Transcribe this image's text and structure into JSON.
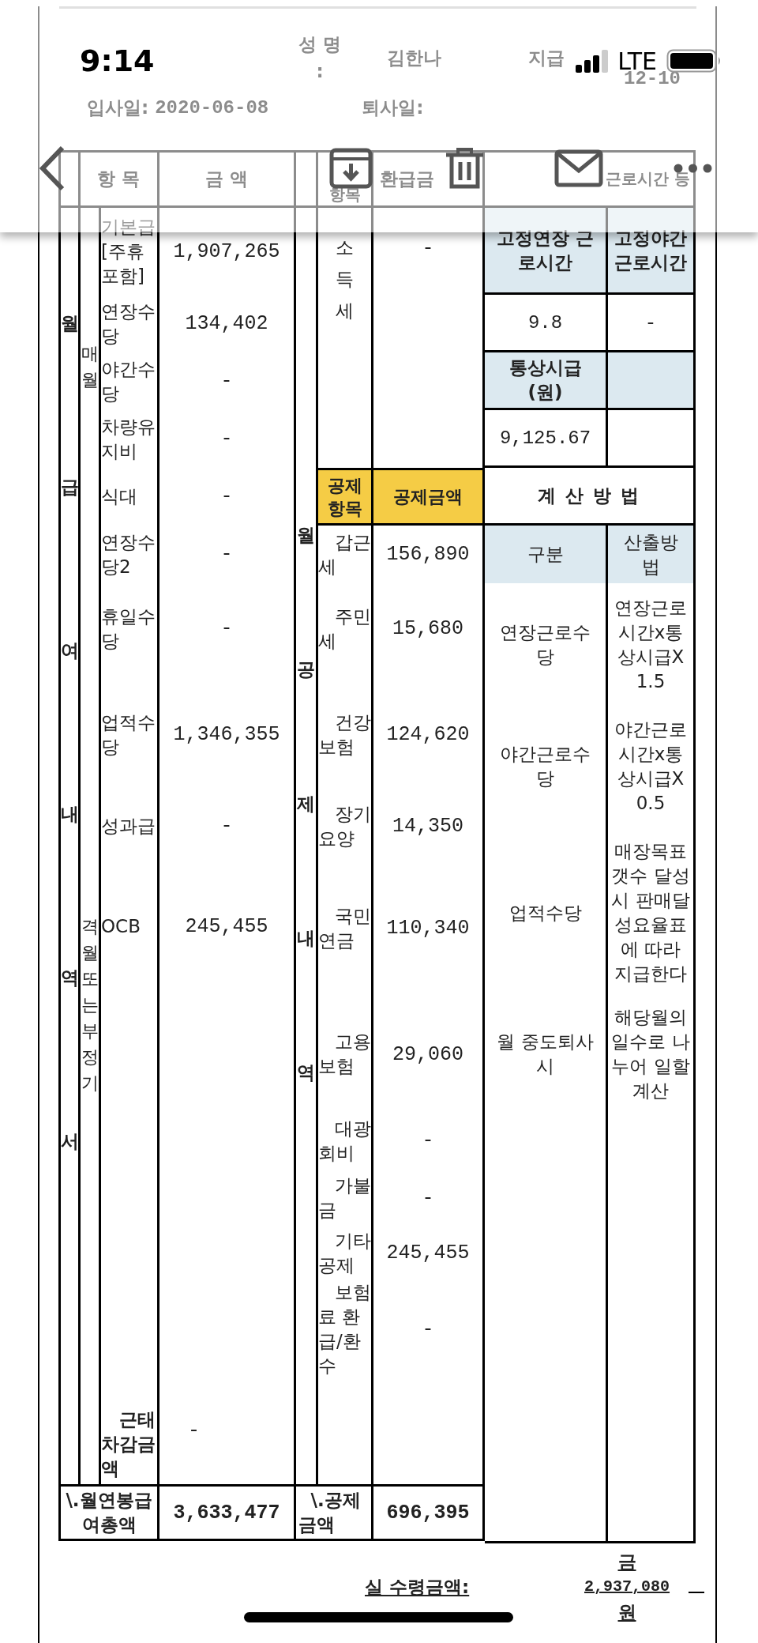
{
  "status_bar": {
    "time": "9:14",
    "network": "LTE"
  },
  "document_header": {
    "name_label": "성 명 :",
    "name": "김한나",
    "pay_date_label": "지급",
    "pay_date": "12-10",
    "hire_date_label": "입사일:",
    "hire_date": "2020-06-08",
    "leave_date_label": "퇴사일:"
  },
  "table_header": {
    "item": "항 목",
    "amount": "금 액",
    "deduction_item": "항목",
    "deduction_amount": "환급금",
    "hours": "근로시간 등"
  },
  "earnings": {
    "section_label": "월급여내역서",
    "groups": [
      {
        "label": "매월",
        "rows": [
          {
            "kind": "pay",
            "item": "기본급[주휴 포함]",
            "amount": "1,907,265"
          },
          {
            "kind": "pay",
            "item": "연장수당",
            "amount": "134,402"
          },
          {
            "kind": "pay",
            "item": "야간수당",
            "amount": "-"
          },
          {
            "kind": "pay",
            "item": "차량유지비",
            "amount": "-"
          },
          {
            "kind": "pay",
            "item": "식대",
            "amount": "-"
          }
        ]
      },
      {
        "label": "격월또는부정기",
        "rows": [
          {
            "kind": "pay",
            "item": "연장수당2",
            "amount": "-"
          },
          {
            "kind": "pay",
            "item": "휴일수당",
            "amount": "-"
          },
          {
            "kind": "pay",
            "item": "업적수당",
            "amount": "1,346,355"
          },
          {
            "kind": "pay",
            "item": "성과급",
            "amount": "-"
          },
          {
            "kind": "pay",
            "item": "OCB",
            "amount": "245,455"
          },
          {
            "kind": "attendance",
            "item": "근태차감금액",
            "amount": "-"
          }
        ]
      }
    ],
    "total": {
      "label": "\\.월연봉급여총액",
      "amount": "3,633,477"
    }
  },
  "deductions": {
    "section_label": "월공제내역",
    "income_tax": {
      "item": "소득세",
      "amount": "-"
    },
    "columns": [
      "공제항목",
      "공제금액"
    ],
    "rows": [
      {
        "item": "갑근세",
        "amount": "156,890"
      },
      {
        "item": "주민세",
        "amount": "15,680"
      },
      {
        "item": "건강보험",
        "amount": "124,620"
      },
      {
        "item": "장기요양",
        "amount": "14,350"
      },
      {
        "item": "국민연금",
        "amount": "110,340"
      },
      {
        "item": "고용보험",
        "amount": "29,060"
      },
      {
        "item": "대광회비",
        "amount": "-"
      },
      {
        "item": "가불금",
        "amount": "-"
      },
      {
        "item": "기타공제",
        "amount": "245,455"
      },
      {
        "item": "보험료 환급/환수",
        "amount": "-"
      }
    ],
    "total": {
      "label": "\\.공제금액",
      "amount": "696,395"
    }
  },
  "work_hours": {
    "columns": [
      "고정연장 근로시간",
      "고정야간 근로시간"
    ],
    "values": [
      "9.8",
      "-"
    ],
    "rate_label": "통상시급 (원)",
    "rate": "9,125.67"
  },
  "calculation": {
    "title": "계 산 방 법",
    "columns": [
      "구분",
      "산출방법"
    ],
    "rows": [
      {
        "category": "연장근로수당",
        "formula": "연장근로시간x통상시급X1.5"
      },
      {
        "category": "야간근로수당",
        "formula": "야간근로시간x통상시급X0.5"
      },
      {
        "category": "업적수당",
        "formula": "매장목표갯수 달성시 판매달성요율표에 따라 지급한다"
      },
      {
        "category": "월 중도퇴사시",
        "formula": "해당월의 일수로 나누어 일할계산"
      }
    ]
  },
  "net_pay": {
    "label": "실 수령금액:",
    "prefix": "금",
    "amount": "2,937,080",
    "unit": "원"
  }
}
